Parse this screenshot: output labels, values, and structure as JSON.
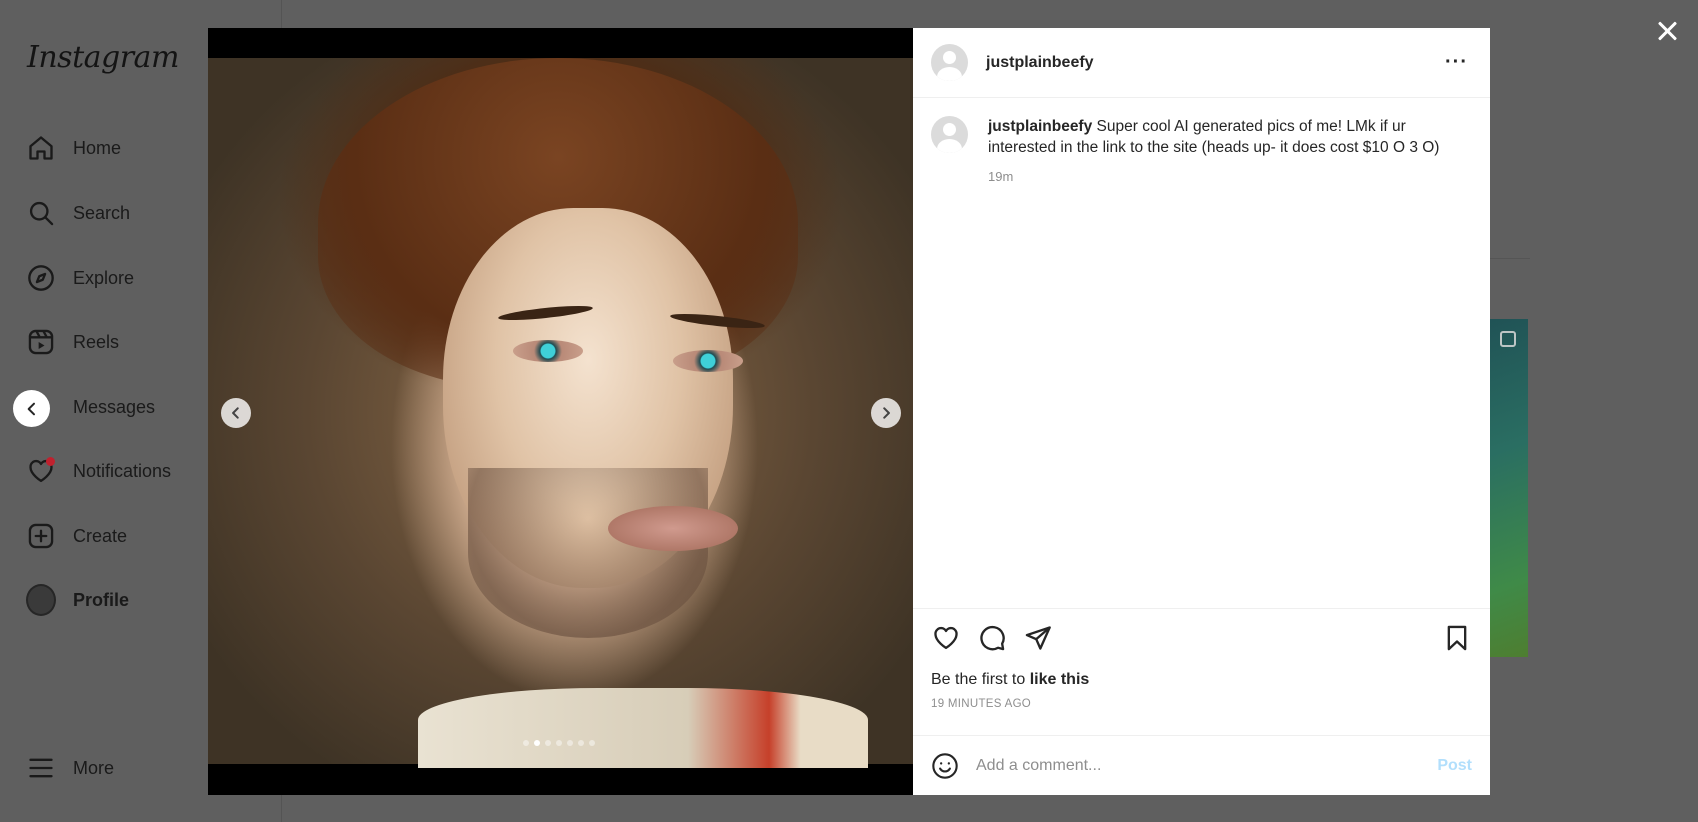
{
  "sidebar": {
    "logo": "Instagram",
    "items": [
      {
        "label": "Home",
        "icon": "home-icon"
      },
      {
        "label": "Search",
        "icon": "search-icon"
      },
      {
        "label": "Explore",
        "icon": "compass-icon"
      },
      {
        "label": "Reels",
        "icon": "reels-icon"
      },
      {
        "label": "Messages",
        "icon": "messenger-icon"
      },
      {
        "label": "Notifications",
        "icon": "heart-icon"
      },
      {
        "label": "Create",
        "icon": "plus-square-icon"
      },
      {
        "label": "Profile",
        "icon": "avatar"
      }
    ],
    "more_label": "More"
  },
  "post": {
    "username": "justplainbeefy",
    "caption_user": "justplainbeefy",
    "caption_text": "Super cool AI generated pics of me! LMk if ur interested in the link to the site (heads up- it does cost $10 O 3 O)",
    "caption_time": "19m",
    "likes_prefix": "Be the first to",
    "likes_action": "like this",
    "timestamp": "19 MINUTES AGO",
    "carousel": {
      "count": 7,
      "active_index": 1
    }
  },
  "comment": {
    "placeholder": "Add a comment...",
    "post_label": "Post"
  },
  "colors": {
    "overlay": "#5f5f5f",
    "post_button": "#b2dffc",
    "notification_dot": "#c0212e"
  }
}
